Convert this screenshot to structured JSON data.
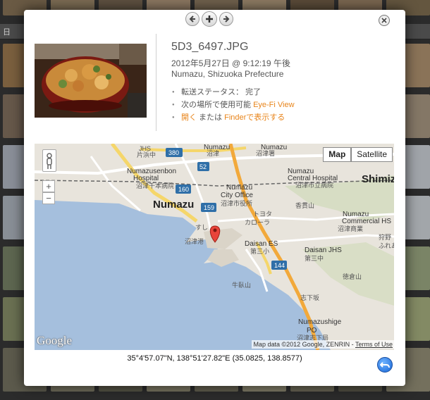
{
  "background": {
    "toolbar_text": "日"
  },
  "modal": {
    "nav": {
      "prev_icon": "arrow-left-icon",
      "add_icon": "plus-icon",
      "next_icon": "arrow-right-icon"
    },
    "close_icon": "close-icon",
    "photo": {
      "alt": "rice bowl"
    },
    "filename": "5D3_6497.JPG",
    "date": "2012年5月27日 @ 9:12:19 午後",
    "location": "Numazu, Shizuoka Prefecture",
    "facts": {
      "transfer_status": "転送ステータス： 完了",
      "available_prefix": "次の場所で使用可能 ",
      "available_link": "Eye-Fi View",
      "open_link": "開く",
      "or_text": " または ",
      "finder_link": "Finderで表示する"
    },
    "map": {
      "map_button": "Map",
      "satellite_button": "Satellite",
      "zoom_in": "+",
      "zoom_out": "−",
      "logo": "Google",
      "copyright": "Map data ©2012 Google, ZENRIN - ",
      "terms": "Terms of Use",
      "labels": {
        "jhs": "JHS",
        "kataoka": "片浜中",
        "numazu_top": "Numazu",
        "numazu_top_jp": "沼津",
        "numazu_kyo": "沼津署",
        "r380": "380",
        "r52": "52",
        "numazu_sta": "沼津",
        "numazu_central": "Numazu",
        "numazu_central2": "Central Hospital",
        "numazu_central_jp": "沼津市立病院",
        "shimizu": "Shimiz",
        "numazusenbon": "Numazusenbon",
        "hospital": "Hospital",
        "senbon_jp": "沼津千本病院",
        "r160": "160",
        "numazu_city": "Numazu",
        "city_office": "City Office",
        "city_office_jp": "沼津市役所",
        "numazu_big": "Numazu",
        "kakisaki": "香貫山",
        "r159": "159",
        "toyota": "トヨタ",
        "corolla": "カローラ",
        "numazu_commercial": "Numazu",
        "commercial_hs": "Commercial HS",
        "commercial_jp": "沼津商業",
        "karino": "狩野",
        "fureai": "ふれあ",
        "numazuko": "沼津港",
        "daisan_es": "Daisan ES",
        "daisan_es_jp": "第三小",
        "daisan_jhs": "Daisan JHS",
        "daisan_jhs_jp": "第三中",
        "r144": "144",
        "tokuraya": "徳倉山",
        "ushibuseyama": "牛臥山",
        "shimokagami": "志下坂",
        "numazushige": "Numazushige",
        "po": "PO",
        "shige_po_jp": "沼津志下局",
        "suruga": "すし"
      }
    },
    "coordinates": "35°4'57.07\"N, 138°51'27.82\"E (35.0825, 138.8577)",
    "back_icon": "undo-arrow-icon"
  }
}
